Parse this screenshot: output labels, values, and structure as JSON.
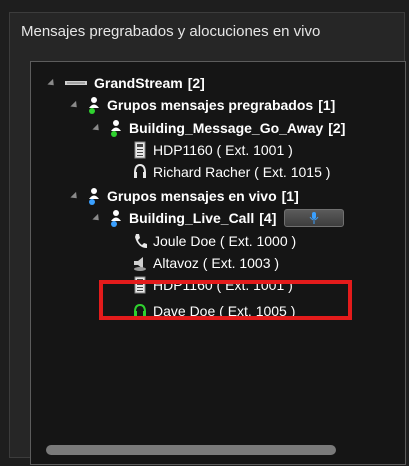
{
  "panel": {
    "title": "Mensajes pregrabados y alocuciones en vivo"
  },
  "tree": {
    "root": {
      "label": "GrandStream",
      "count": "[2]"
    },
    "groups": [
      {
        "label": "Grupos mensajes pregrabados",
        "count": "[1]",
        "sub": {
          "label": "Building_Message_Go_Away",
          "count": "[2]",
          "items": [
            "HDP1160 ( Ext. 1001 )",
            "Richard Racher ( Ext. 1015 )"
          ]
        }
      },
      {
        "label": "Grupos mensajes en vivo",
        "count": "[1]",
        "sub": {
          "label": "Building_Live_Call",
          "count": "[4]",
          "items": [
            "Joule Doe ( Ext. 1000 )",
            "Altavoz ( Ext. 1003 )",
            "HDP1160 ( Ext. 1001 )",
            "Dave Doe ( Ext. 1005 )"
          ]
        }
      }
    ]
  },
  "colors": {
    "highlight": "#e31b1b",
    "accent_blue": "#3aa0ff",
    "headset_green": "#2fd22f"
  }
}
